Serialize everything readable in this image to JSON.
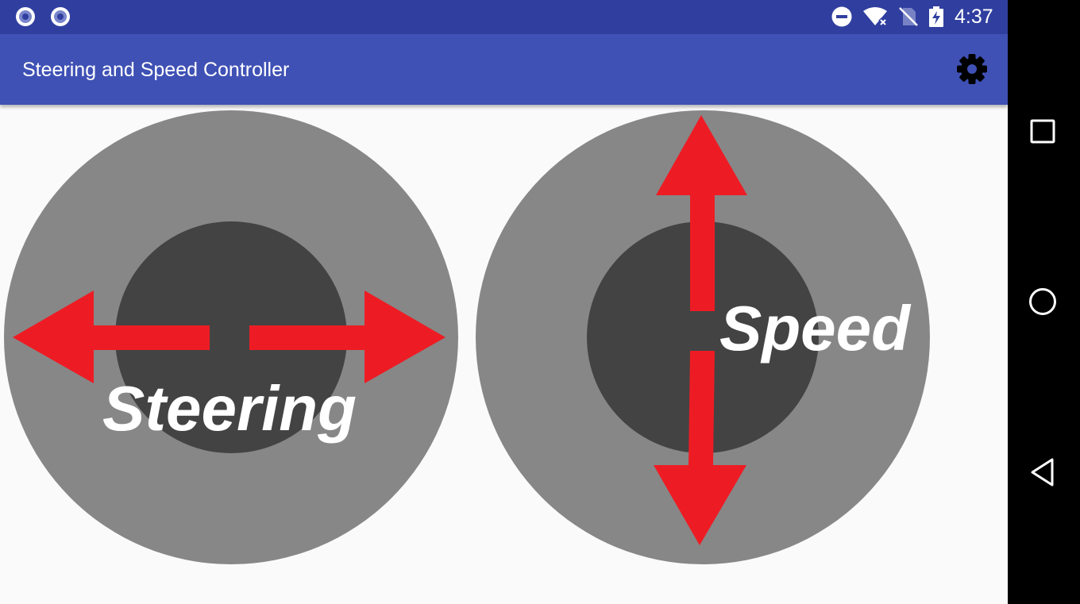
{
  "status_bar": {
    "time": "4:37",
    "left_icons": [
      "notification-dot-icon",
      "notification-dot-icon"
    ],
    "right_icons": [
      "do-not-disturb-icon",
      "wifi-no-internet-icon",
      "no-sim-icon",
      "battery-charging-icon"
    ],
    "colors": {
      "background": "#303f9f",
      "foreground": "#ffffff"
    }
  },
  "app_bar": {
    "title": "Steering and Speed Controller",
    "action_icon": "gear-icon",
    "colors": {
      "background": "#3f51b5",
      "foreground": "#ffffff"
    }
  },
  "joysticks": {
    "steering": {
      "label": "Steering",
      "arrows": "left-right"
    },
    "speed": {
      "label": "Speed",
      "arrows": "up-down"
    },
    "colors": {
      "outer": "#878787",
      "inner": "#434343",
      "arrow": "#ed1c24",
      "label": "#ffffff"
    }
  },
  "nav_bar": {
    "buttons": [
      "recents-icon",
      "home-icon",
      "back-icon"
    ],
    "colors": {
      "background": "#000000",
      "icon": "#ffffff"
    }
  }
}
